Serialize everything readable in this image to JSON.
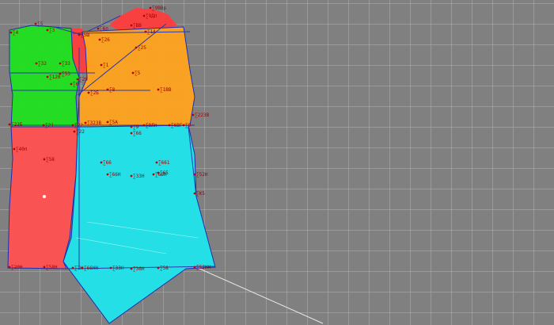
{
  "canvas": {
    "background": "#808080",
    "grid_color": "#b0b0b0",
    "highlight_dot_color": "#ffffff"
  },
  "colors": {
    "sleeve_green": "#1ee01e",
    "yoke_orange": "#ffa21e",
    "collar_red": "#ff3c3c",
    "side_red": "#ff5050",
    "front_cyan": "#1fe4ea",
    "construction_line": "#2b3aa8",
    "label_red": "#a00000",
    "guide_line": "#e8e8e8"
  },
  "pieces": [
    {
      "name": "sleeve-piece-green",
      "color_key": "sleeve_green"
    },
    {
      "name": "collar-piece-red",
      "color_key": "collar_red"
    },
    {
      "name": "yoke-piece-orange",
      "color_key": "yoke_orange"
    },
    {
      "name": "side-piece-red",
      "color_key": "side_red"
    },
    {
      "name": "front-piece-cyan",
      "color_key": "front_cyan"
    }
  ],
  "labels": [
    {
      "id": "l1",
      "text": "∑9ВВр"
    },
    {
      "id": "l2",
      "text": "∑9Дп"
    },
    {
      "id": "l3",
      "text": "∑ВВ"
    },
    {
      "id": "l4",
      "text": "∑6п"
    },
    {
      "id": "l5",
      "text": "∑5"
    },
    {
      "id": "l6",
      "text": "∑3"
    },
    {
      "id": "l7",
      "text": "∑4"
    },
    {
      "id": "l8",
      "text": "∑5Ш"
    },
    {
      "id": "l9",
      "text": "∑1А"
    },
    {
      "id": "l10",
      "text": "∑26"
    },
    {
      "id": "l11",
      "text": "∑25"
    },
    {
      "id": "l12",
      "text": "∑33"
    },
    {
      "id": "l13",
      "text": "∑32"
    },
    {
      "id": "l14",
      "text": "∑120"
    },
    {
      "id": "l15",
      "text": "∑53"
    },
    {
      "id": "l16",
      "text": "∑29"
    },
    {
      "id": "l17",
      "text": "∑1"
    },
    {
      "id": "l18",
      "text": "∑5"
    },
    {
      "id": "l19",
      "text": "∑6"
    },
    {
      "id": "l20",
      "text": "∑8"
    },
    {
      "id": "l21",
      "text": "∑1ВВ"
    },
    {
      "id": "l22",
      "text": "∑2Б"
    },
    {
      "id": "l23",
      "text": "∑22ЗВ"
    },
    {
      "id": "l24",
      "text": "∑22Б"
    },
    {
      "id": "l25",
      "text": "∑21"
    },
    {
      "id": "l26",
      "text": "∑22"
    },
    {
      "id": "l27",
      "text": "∑5А"
    },
    {
      "id": "l28",
      "text": "∑9Лп"
    },
    {
      "id": "l29",
      "text": "∑6ВГ"
    },
    {
      "id": "l30",
      "text": "∑9"
    },
    {
      "id": "l31",
      "text": "∑32ЗВ"
    },
    {
      "id": "l32",
      "text": "∑9"
    },
    {
      "id": "l33",
      "text": "∑22"
    },
    {
      "id": "l34",
      "text": "∑66"
    },
    {
      "id": "l35",
      "text": "∑40п"
    },
    {
      "id": "l36",
      "text": "∑58"
    },
    {
      "id": "l37",
      "text": "∑66"
    },
    {
      "id": "l38",
      "text": "∑65"
    },
    {
      "id": "l39",
      "text": "∑661"
    },
    {
      "id": "l40",
      "text": "∑66Н"
    },
    {
      "id": "l41",
      "text": "∑33Н"
    },
    {
      "id": "l42",
      "text": "∑66Н"
    },
    {
      "id": "l43",
      "text": "∑52Н"
    },
    {
      "id": "l44",
      "text": "∑К5"
    },
    {
      "id": "l45",
      "text": "∑7Н"
    },
    {
      "id": "l46",
      "text": "∑20Н"
    },
    {
      "id": "l47",
      "text": "∑58Н"
    },
    {
      "id": "l48",
      "text": "∑66НН"
    },
    {
      "id": "l49",
      "text": "∑33Н"
    },
    {
      "id": "l50",
      "text": "∑36Н"
    },
    {
      "id": "l51",
      "text": "∑58"
    },
    {
      "id": "l52",
      "text": "∑52НН"
    }
  ]
}
